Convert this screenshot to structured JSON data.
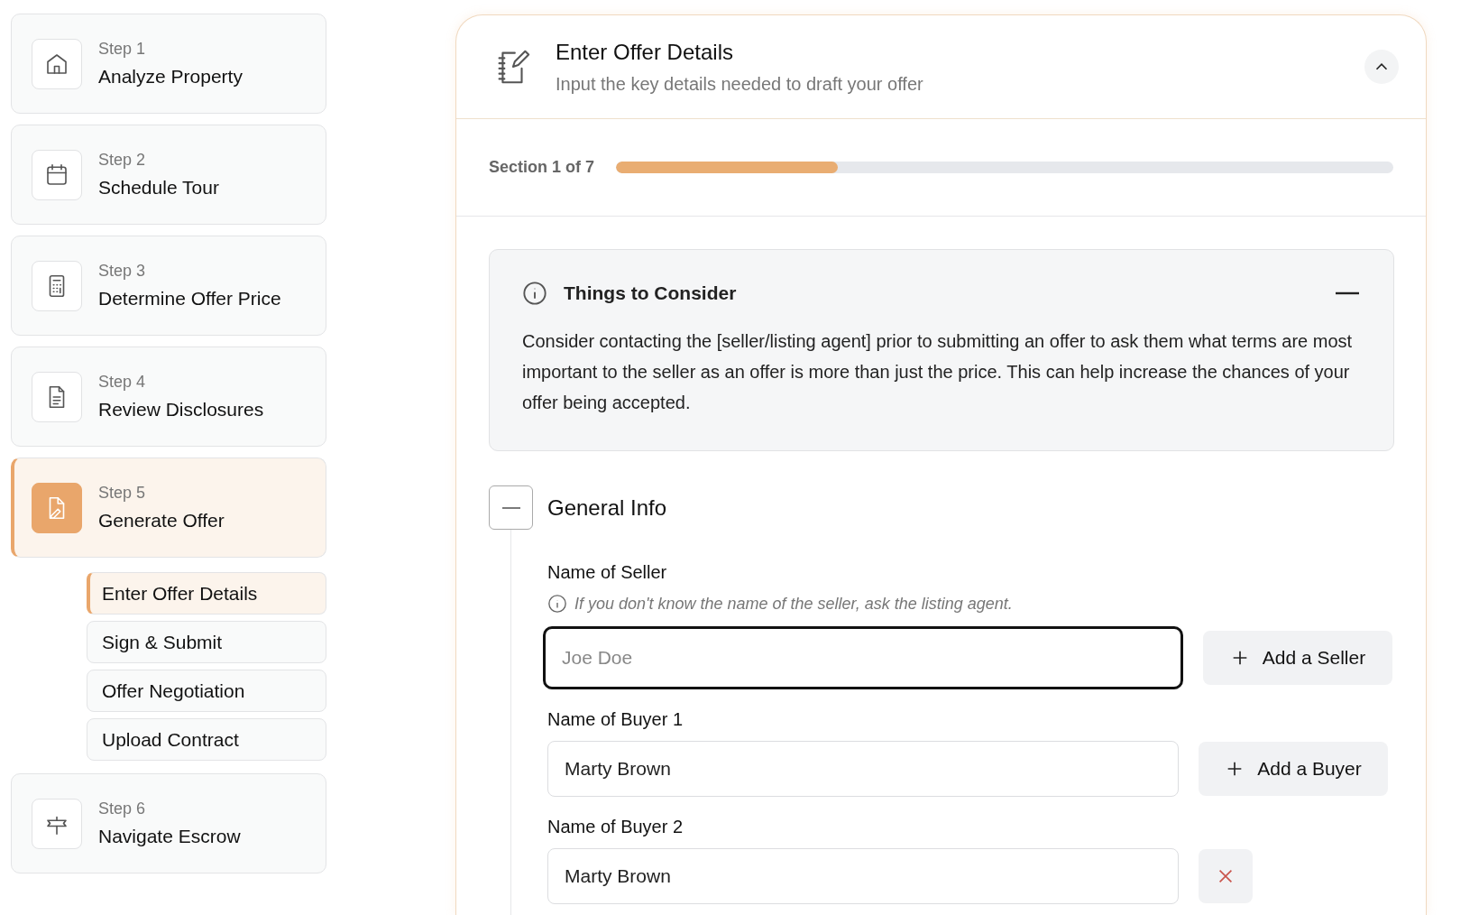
{
  "steps": [
    {
      "step": "Step 1",
      "title": "Analyze Property",
      "selected": false
    },
    {
      "step": "Step 2",
      "title": "Schedule Tour",
      "selected": false
    },
    {
      "step": "Step 3",
      "title": "Determine Offer Price",
      "selected": false
    },
    {
      "step": "Step 4",
      "title": "Review Disclosures",
      "selected": false
    },
    {
      "step": "Step 5",
      "title": "Generate Offer",
      "selected": true,
      "children": [
        {
          "title": "Enter Offer Details",
          "selected": true
        },
        {
          "title": "Sign & Submit",
          "selected": false
        },
        {
          "title": "Offer Negotiation",
          "selected": false
        },
        {
          "title": "Upload Contract",
          "selected": false
        }
      ]
    },
    {
      "step": "Step 6",
      "title": "Navigate Escrow",
      "selected": false
    }
  ],
  "panel": {
    "title": "Enter Offer Details",
    "subtitle": "Input the key details needed to draft your offer",
    "expanded": true
  },
  "progress": {
    "label": "Section 1 of 7",
    "level": 0.285
  },
  "notice": {
    "title": "Things to Consider",
    "text": "Consider contacting the [seller/listing agent] prior to submitting an offer to ask them what terms are most important to the seller as an offer is more than just the price. This can help increase the chances of your offer being accepted."
  },
  "section": {
    "title": "General Info",
    "expanded": true,
    "fields": [
      {
        "label": "Name of Seller",
        "hint": "If you don't know the name of the seller, ask the listing agent.",
        "placeholder": "Joe Doe",
        "focused": true,
        "action": {
          "kind": "add",
          "label": "Add a Seller"
        }
      },
      {
        "label": "Name of Buyer 1",
        "value": "Marty Brown",
        "focused": false,
        "action": {
          "kind": "add",
          "label": "Add a Buyer"
        }
      },
      {
        "label": "Name of Buyer 2",
        "value": "Marty Brown",
        "focused": false,
        "action": {
          "kind": "remove"
        }
      }
    ]
  }
}
